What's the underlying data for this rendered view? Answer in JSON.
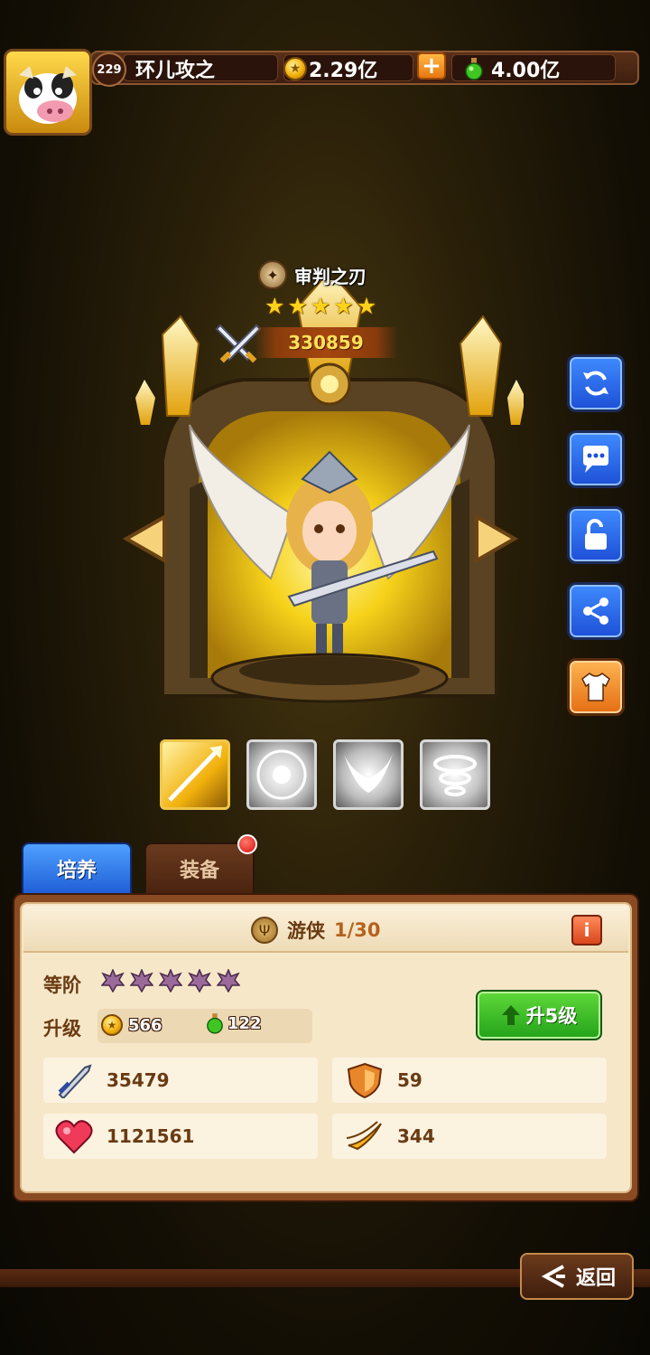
{
  "player": {
    "level": "229",
    "name": "环儿攻之",
    "gold": "2.29亿",
    "potion": "4.00亿"
  },
  "hero": {
    "name": "审判之刃",
    "star_count": 5,
    "power": "330859"
  },
  "side_buttons": [
    "refresh-icon",
    "chat-icon",
    "unlock-icon",
    "share-icon",
    "skin-icon"
  ],
  "tabs": {
    "train": "培养",
    "equip": "装备"
  },
  "panel": {
    "class_name": "游侠",
    "class_level": "1/30",
    "rank_label": "等阶",
    "upgrade_label": "升级",
    "rank_star_count": 5,
    "cost_gold": "566",
    "cost_potion": "122",
    "upgrade_button": "升5级"
  },
  "stats": {
    "attack": "35479",
    "defense": "59",
    "hp": "1121561",
    "speed": "344"
  },
  "back_label": "返回",
  "colors": {
    "accent_gold": "#ffd21a",
    "tab_active": "#1f5fd6",
    "upgrade_green": "#24a21a",
    "panel_bg": "#f6e7c9"
  }
}
